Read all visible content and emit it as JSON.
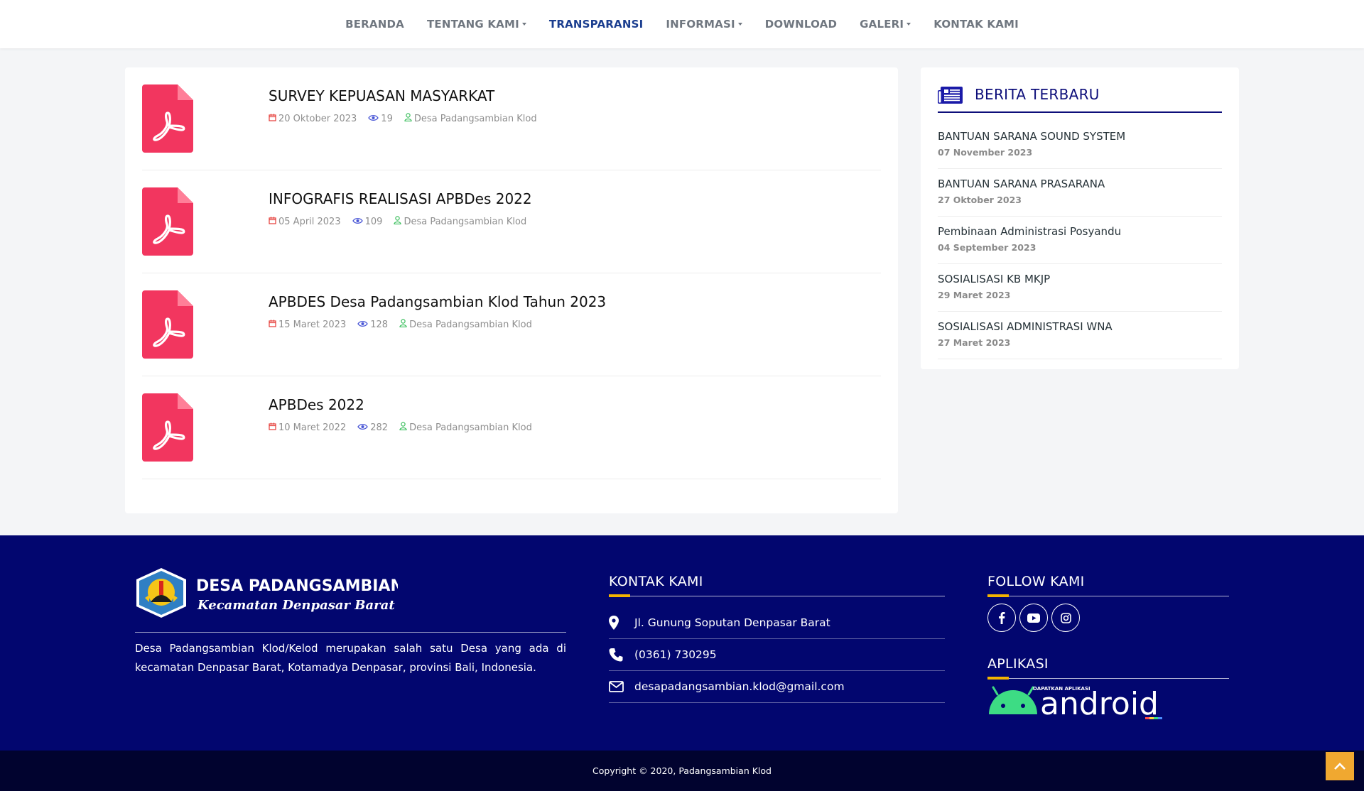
{
  "nav": {
    "items": [
      {
        "label": "BERANDA",
        "dropdown": false,
        "active": false
      },
      {
        "label": "TENTANG KAMI",
        "dropdown": true,
        "active": false
      },
      {
        "label": "TRANSPARANSI",
        "dropdown": false,
        "active": true
      },
      {
        "label": "INFORMASI",
        "dropdown": true,
        "active": false
      },
      {
        "label": "DOWNLOAD",
        "dropdown": false,
        "active": false
      },
      {
        "label": "GALERI",
        "dropdown": true,
        "active": false
      },
      {
        "label": "KONTAK KAMI",
        "dropdown": false,
        "active": false
      }
    ]
  },
  "documents": [
    {
      "title": "SURVEY KEPUASAN MASYARKAT",
      "date": "20 Oktober 2023",
      "views": "19",
      "author": "Desa Padangsambian Klod",
      "icon": "pdf-file-icon"
    },
    {
      "title": "INFOGRAFIS REALISASI APBDes 2022",
      "date": "05 April 2023",
      "views": "109",
      "author": "Desa Padangsambian Klod",
      "icon": "pdf-file-icon"
    },
    {
      "title": "APBDES Desa Padangsambian Klod Tahun 2023",
      "date": "15 Maret 2023",
      "views": "128",
      "author": "Desa Padangsambian Klod",
      "icon": "pdf-file-icon"
    },
    {
      "title": "APBDes 2022",
      "date": "10 Maret 2022",
      "views": "282",
      "author": "Desa Padangsambian Klod",
      "icon": "pdf-file-icon"
    }
  ],
  "sidebar": {
    "title": "BERITA TERBARU",
    "icon": "newspaper-icon",
    "news": [
      {
        "title": "BANTUAN SARANA SOUND SYSTEM",
        "date": "07 November 2023"
      },
      {
        "title": "BANTUAN SARANA PRASARANA",
        "date": "27 Oktober 2023"
      },
      {
        "title": "Pembinaan Administrasi Posyandu",
        "date": "04 September 2023"
      },
      {
        "title": "SOSIALISASI KB MKJP",
        "date": "29 Maret 2023"
      },
      {
        "title": "SOSIALISASI ADMINISTRASI WNA",
        "date": "27 Maret 2023"
      }
    ]
  },
  "footer": {
    "logo_title": "DESA PADANGSAMBIAN KLOD",
    "logo_subtitle": "Kecamatan Denpasar Barat",
    "description": "Desa Padangsambian Klod/Kelod merupakan salah satu Desa yang ada di kecamatan Denpasar Barat, Kotamadya Denpasar, provinsi Bali, Indonesia.",
    "contact_title": "KONTAK KAMI",
    "contacts": [
      {
        "icon": "map-marker-icon",
        "text": "Jl. Gunung Soputan Denpasar Barat"
      },
      {
        "icon": "phone-icon",
        "text": "(0361) 730295"
      },
      {
        "icon": "envelope-icon",
        "text": "desapadangsambian.klod@gmail.com"
      }
    ],
    "follow_title": "FOLLOW KAMI",
    "socials": [
      "facebook-icon",
      "youtube-icon",
      "instagram-icon"
    ],
    "app_title": "APLIKASI",
    "android_small": "DAPATKAN APLIKASI",
    "android_big": "android",
    "copyright": "Copyright © 2020, Padangsambian Klod"
  },
  "colors": {
    "accent": "#1b3e8f",
    "pdf": "#f2365f",
    "footer_bg": "#02066f",
    "footer_bottom": "#01032f",
    "to_top": "#f0a830"
  }
}
